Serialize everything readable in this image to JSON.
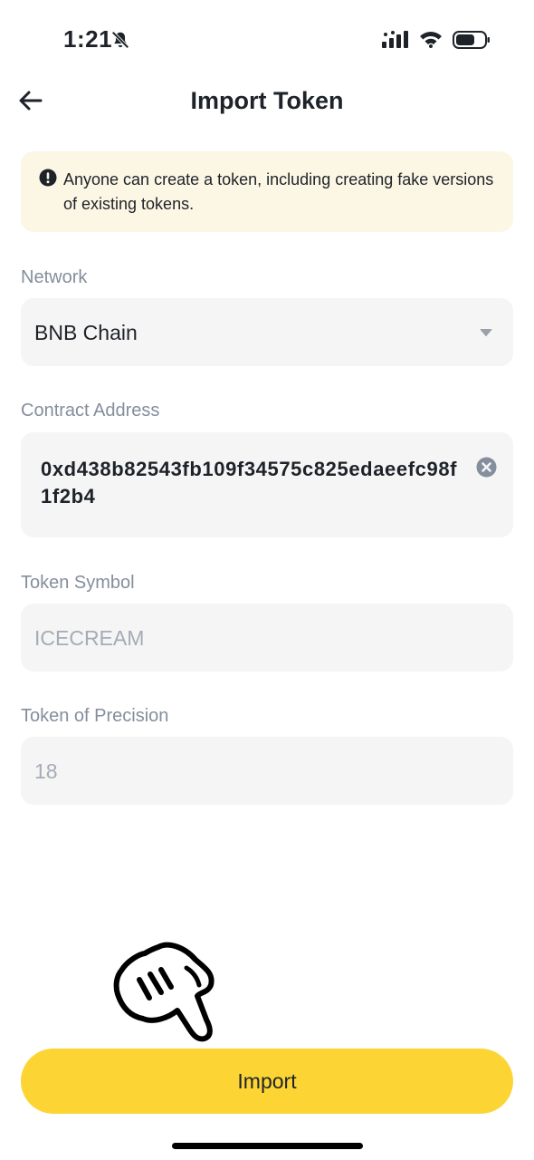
{
  "status_bar": {
    "time": "1:21",
    "icons": [
      "bell-slash-icon",
      "signal-icon",
      "wifi-icon",
      "battery-icon"
    ]
  },
  "header": {
    "back_icon": "arrow-left-icon",
    "title": "Import Token"
  },
  "warning": {
    "icon": "exclamation-circle-icon",
    "text": "Anyone can create a token, including creating fake versions of existing tokens."
  },
  "form": {
    "network": {
      "label": "Network",
      "value": "BNB Chain",
      "icon": "caret-down-icon"
    },
    "contract_address": {
      "label": "Contract Address",
      "value": "0xd438b82543fb109f34575c825edaeefc98f1f2b4",
      "icon": "clear-icon"
    },
    "token_symbol": {
      "label": "Token Symbol",
      "value": "ICECREAM"
    },
    "token_precision": {
      "label": "Token of Precision",
      "value": "18"
    }
  },
  "overlay": {
    "icon": "pointing-hand-icon"
  },
  "footer": {
    "import_label": "Import"
  },
  "colors": {
    "accent": "#fcd535",
    "warning_bg": "#fcf6e4",
    "field_bg": "#f5f5f5",
    "label": "#848e9c",
    "text": "#1e2329"
  }
}
